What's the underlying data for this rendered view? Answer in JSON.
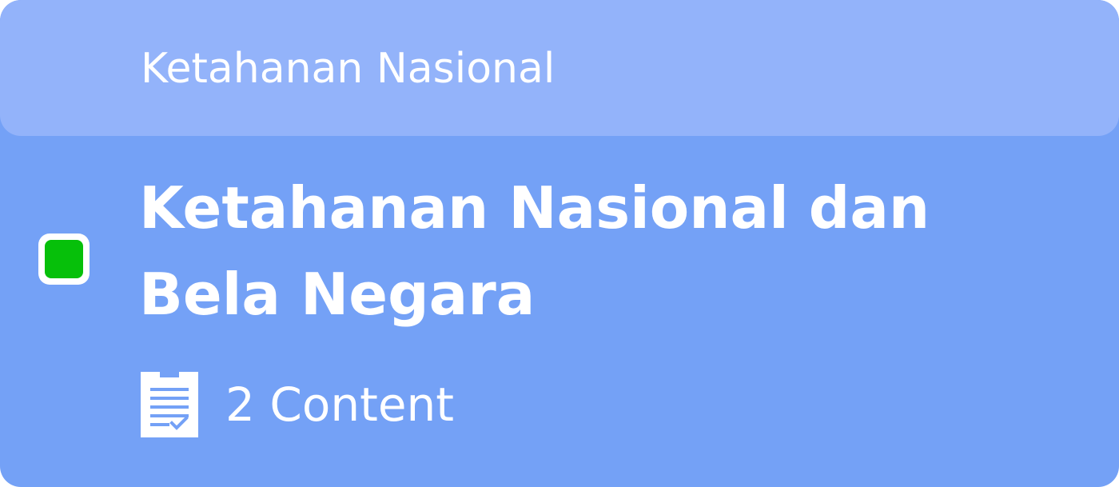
{
  "card": {
    "header_title": "Ketahanan Nasional",
    "title": "Ketahanan Nasional dan Bela Negara",
    "status_color": "#06c00a",
    "content_icon": "clipboard-check-icon",
    "content_count": "2 Content"
  },
  "colors": {
    "body": "#74a1f6",
    "header": "#93b3fa",
    "text": "#ffffff"
  }
}
